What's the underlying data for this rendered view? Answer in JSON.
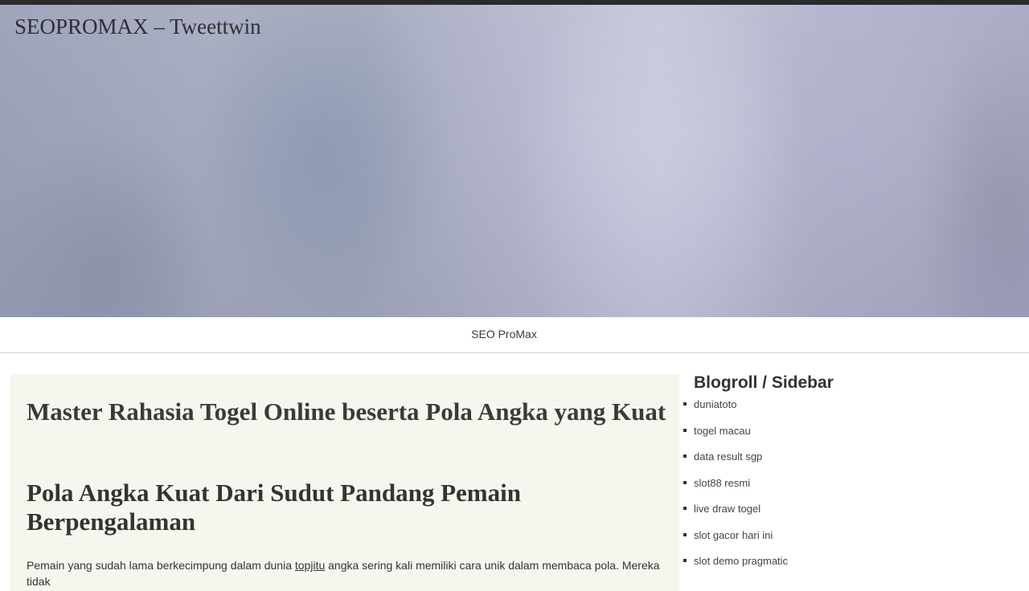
{
  "header": {
    "site_title": "SEOPROMAX – Tweettwin"
  },
  "nav": {
    "home_label": "SEO ProMax"
  },
  "post": {
    "title": "Master Rahasia Togel Online beserta Pola Angka yang Kuat",
    "subtitle": "Pola Angka Kuat Dari Sudut Pandang Pemain Berpengalaman",
    "body_before_link": "Pemain yang sudah lama berkecimpung dalam dunia ",
    "body_link": "topjitu",
    "body_after_link": " angka sering kali memiliki cara unik dalam membaca pola. Mereka tidak"
  },
  "sidebar": {
    "title": "Blogroll / Sidebar",
    "items": [
      {
        "label": "duniatoto"
      },
      {
        "label": "togel macau"
      },
      {
        "label": "data result sgp"
      },
      {
        "label": "slot88 resmi"
      },
      {
        "label": "live draw togel"
      },
      {
        "label": "slot gacor hari ini"
      },
      {
        "label": "slot demo pragmatic"
      }
    ]
  }
}
